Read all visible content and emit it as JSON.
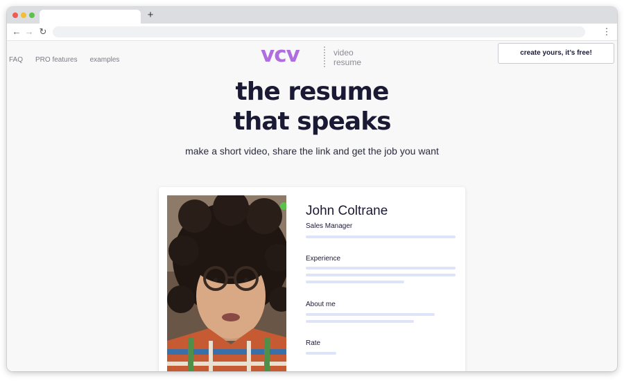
{
  "browser": {
    "new_tab_label": "+",
    "back_glyph": "←",
    "forward_glyph": "→",
    "reload_glyph": "↻",
    "menu_glyph": "⋮",
    "traffic_lights": [
      "#ee5c53",
      "#f3be33",
      "#5ac24a"
    ]
  },
  "header": {
    "nav": [
      "FAQ",
      "PRO features",
      "examples"
    ],
    "logo": {
      "mark": "vcv",
      "line1": "video",
      "line2": "resume",
      "color": "#b06de0"
    },
    "cta_label": "create yours, it’s free!"
  },
  "hero": {
    "line1": "the resume",
    "line2": "that speaks",
    "subtitle": "make a short video, share the link and get the job you want"
  },
  "profile_card": {
    "name": "John Coltrane",
    "role": "Sales Manager",
    "sections": [
      "Experience",
      "About me",
      "Rate"
    ],
    "status_color": "#5ac24a"
  }
}
